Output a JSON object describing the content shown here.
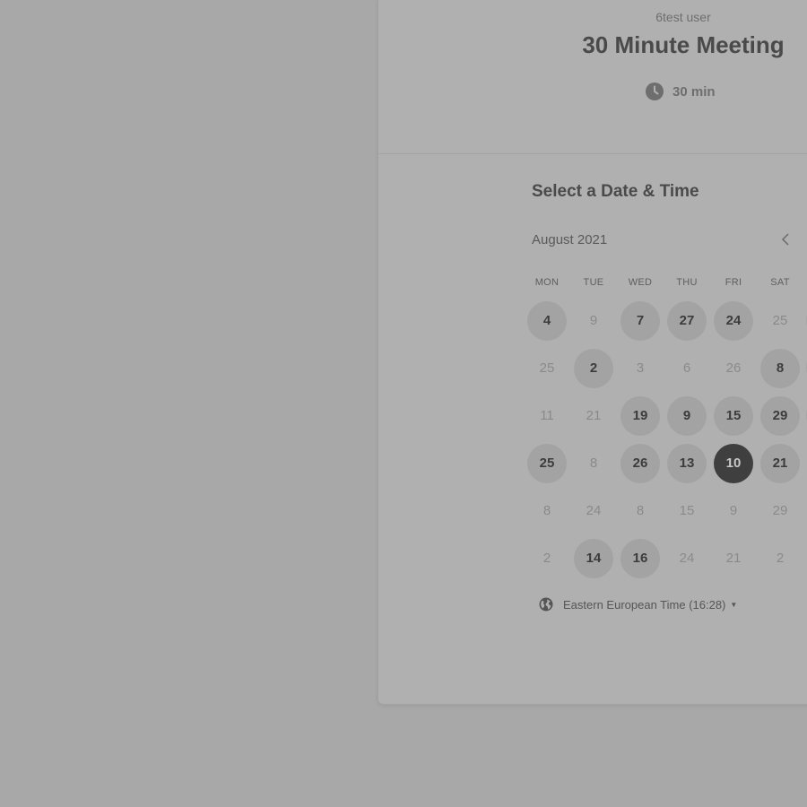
{
  "event": {
    "host": "6test user",
    "title": "30 Minute Meeting",
    "duration": "30 min"
  },
  "scheduler": {
    "heading": "Select a Date & Time",
    "month": "August 2021",
    "weekdays": [
      "MON",
      "TUE",
      "WED",
      "THU",
      "FRI",
      "SAT"
    ],
    "weeks": [
      [
        {
          "d": "4",
          "s": "available"
        },
        {
          "d": "9",
          "s": "unavailable"
        },
        {
          "d": "7",
          "s": "available"
        },
        {
          "d": "27",
          "s": "available"
        },
        {
          "d": "24",
          "s": "available"
        },
        {
          "d": "25",
          "s": "unavailable"
        }
      ],
      [
        {
          "d": "25",
          "s": "unavailable"
        },
        {
          "d": "2",
          "s": "available"
        },
        {
          "d": "3",
          "s": "unavailable"
        },
        {
          "d": "6",
          "s": "unavailable"
        },
        {
          "d": "26",
          "s": "unavailable"
        },
        {
          "d": "8",
          "s": "available"
        }
      ],
      [
        {
          "d": "11",
          "s": "unavailable"
        },
        {
          "d": "21",
          "s": "unavailable"
        },
        {
          "d": "19",
          "s": "available"
        },
        {
          "d": "9",
          "s": "available"
        },
        {
          "d": "15",
          "s": "available"
        },
        {
          "d": "29",
          "s": "available"
        }
      ],
      [
        {
          "d": "25",
          "s": "available"
        },
        {
          "d": "8",
          "s": "unavailable"
        },
        {
          "d": "26",
          "s": "available"
        },
        {
          "d": "13",
          "s": "available"
        },
        {
          "d": "10",
          "s": "selected"
        },
        {
          "d": "21",
          "s": "available"
        }
      ],
      [
        {
          "d": "8",
          "s": "unavailable"
        },
        {
          "d": "24",
          "s": "unavailable"
        },
        {
          "d": "8",
          "s": "unavailable"
        },
        {
          "d": "15",
          "s": "unavailable"
        },
        {
          "d": "9",
          "s": "unavailable"
        },
        {
          "d": "29",
          "s": "unavailable"
        }
      ],
      [
        {
          "d": "2",
          "s": "unavailable"
        },
        {
          "d": "14",
          "s": "available"
        },
        {
          "d": "16",
          "s": "available"
        },
        {
          "d": "24",
          "s": "unavailable"
        },
        {
          "d": "21",
          "s": "unavailable"
        },
        {
          "d": "2",
          "s": "unavailable"
        }
      ]
    ],
    "timezone": "Eastern European Time (16:28)"
  },
  "icons": {
    "clock": "clock-icon",
    "prev": "chevron-left-icon",
    "globe": "globe-icon",
    "dropdown": "caret-down-icon"
  },
  "colors": {
    "overlay_background": "#a8a8a8",
    "card": "#b0b0b0",
    "selected_day": "#3f3f3f",
    "available_day": "#a3a3a3"
  }
}
